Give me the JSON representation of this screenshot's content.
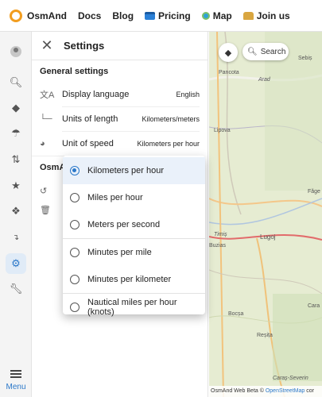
{
  "topbar": {
    "brand": "OsmAnd",
    "nav": [
      {
        "label": "Docs",
        "icon": ""
      },
      {
        "label": "Blog",
        "icon": ""
      },
      {
        "label": "Pricing",
        "icon": "card-icon"
      },
      {
        "label": "Map",
        "icon": "globe-icon"
      },
      {
        "label": "Join us",
        "icon": "hand-icon"
      }
    ]
  },
  "rail": {
    "items": [
      "account-icon",
      "search-icon",
      "layers-icon",
      "weather-icon",
      "route-icon",
      "favorites-icon",
      "navigation-icon",
      "tracks-icon",
      "settings-icon",
      "tools-icon"
    ],
    "menu_label": "Menu"
  },
  "settings": {
    "title": "Settings",
    "general_title": "General settings",
    "rows": [
      {
        "label": "Display language",
        "value": "English"
      },
      {
        "label": "Units of length",
        "value": "Kilometers/meters"
      },
      {
        "label": "Unit of speed",
        "value": "Kilometers per hour"
      }
    ],
    "osm_section_title": "OsmA"
  },
  "speed_dropdown": {
    "options": [
      {
        "label": "Kilometers per hour",
        "selected": true
      },
      {
        "label": "Miles per hour",
        "selected": false
      },
      {
        "label": "Meters per second",
        "selected": false
      },
      {
        "label": "Minutes per mile",
        "selected": false
      },
      {
        "label": "Minutes per kilometer",
        "selected": false
      },
      {
        "label": "Nautical miles per hour (knots)",
        "selected": false
      }
    ]
  },
  "map": {
    "search_label": "Search",
    "towns": [
      "Pancota",
      "Arad",
      "Sebiș",
      "Lipova",
      "Făge",
      "Timiș",
      "Lugoj",
      "Buzias",
      "Bocșa",
      "Reșița",
      "Cara",
      "Caraș-Severin"
    ],
    "attribution_prefix": "OsmAnd Web Beta © ",
    "attribution_link": "OpenStreetMap",
    "attribution_suffix": " cor"
  },
  "colors": {
    "accent": "#2b78c9",
    "brand_orange": "#f29d1f",
    "map_bg": "#e6ecd2"
  }
}
